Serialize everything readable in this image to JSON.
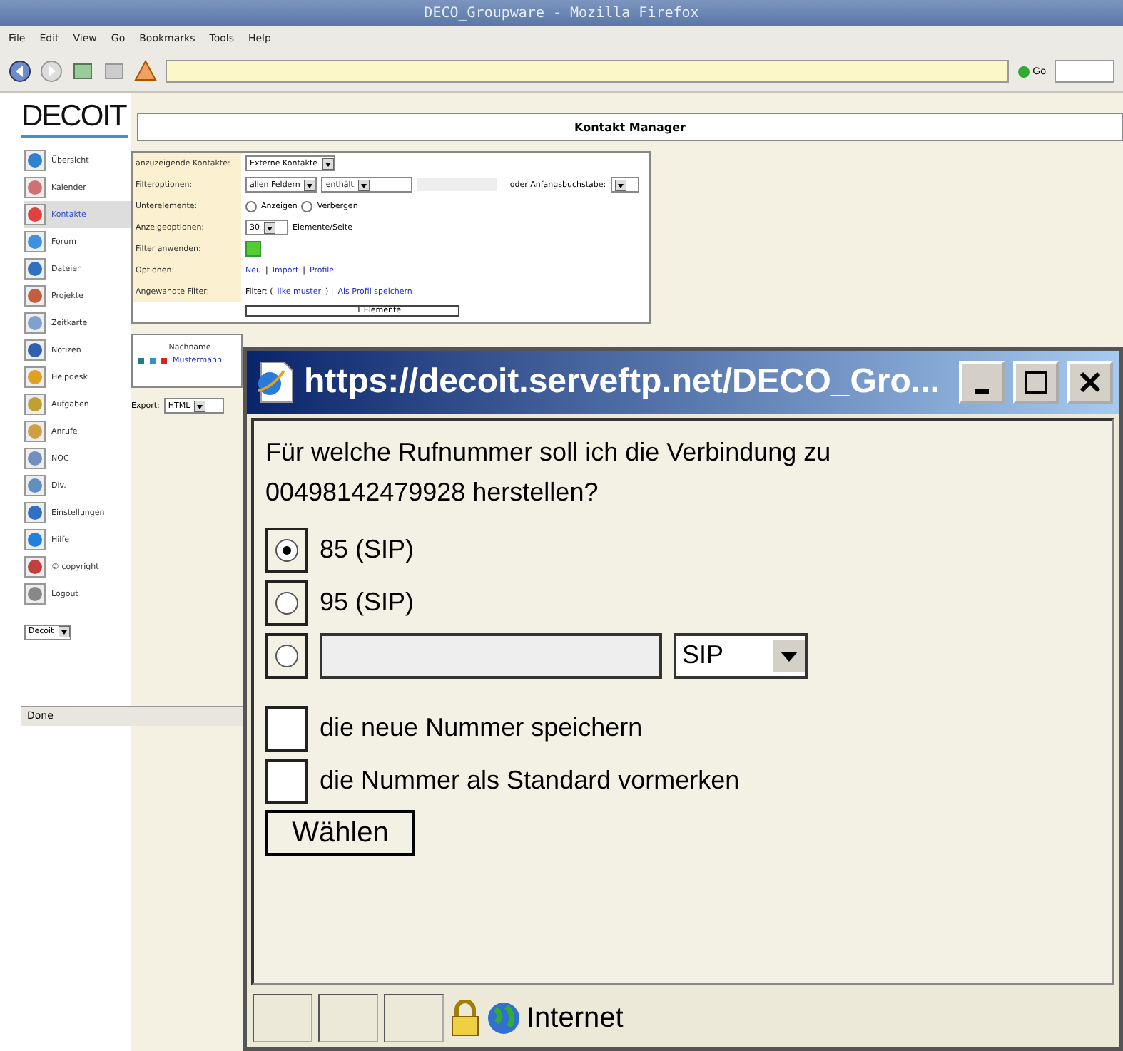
{
  "browser": {
    "title": "DECO_Groupware - Mozilla Firefox",
    "menu": [
      "File",
      "Edit",
      "View",
      "Go",
      "Bookmarks",
      "Tools",
      "Help"
    ],
    "search_button": "Go",
    "status": "Done"
  },
  "logo": "DECOIT",
  "sidebar": {
    "items": [
      {
        "label": "Übersicht",
        "selected": false
      },
      {
        "label": "Kalender",
        "selected": false
      },
      {
        "label": "Kontakte",
        "selected": true
      },
      {
        "label": "Forum",
        "selected": false
      },
      {
        "label": "Dateien",
        "selected": false
      },
      {
        "label": "Projekte",
        "selected": false
      },
      {
        "label": "Zeitkarte",
        "selected": false
      },
      {
        "label": "Notizen",
        "selected": false
      },
      {
        "label": "Helpdesk",
        "selected": false
      },
      {
        "label": "Aufgaben",
        "selected": false
      },
      {
        "label": "Anrufe",
        "selected": false
      },
      {
        "label": "NOC",
        "selected": false
      },
      {
        "label": "Div.",
        "selected": false
      },
      {
        "label": "Einstellungen",
        "selected": false
      },
      {
        "label": "Hilfe",
        "selected": false
      },
      {
        "label": "© copyright",
        "selected": false
      },
      {
        "label": "Logout",
        "selected": false
      }
    ],
    "group_select": "Decoit"
  },
  "header": "Kontakt Manager",
  "filter": {
    "rows": [
      {
        "label": "anzuzeigende Kontakte:",
        "kind": "select",
        "value": "Externe Kontakte"
      },
      {
        "label": "Filteroptionen:",
        "kind": "filter",
        "field": "allen Feldern",
        "op": "enthält",
        "letter_label": "oder Anfangsbuchstabe:"
      },
      {
        "label": "Unterelemente:",
        "kind": "radios",
        "options": [
          {
            "label": "Anzeigen",
            "selected": false
          },
          {
            "label": "Verbergen",
            "selected": false
          }
        ]
      },
      {
        "label": "Anzeigeoptionen:",
        "kind": "count",
        "value": "30",
        "suffix": "Elemente/Seite"
      },
      {
        "label": "Filter anwenden:",
        "kind": "apply"
      },
      {
        "label": "Optionen:",
        "kind": "links",
        "links": [
          "Neu",
          "Import",
          "Profile"
        ],
        "separator": "|"
      },
      {
        "label": "Angewandte Filter:",
        "kind": "applied",
        "prefix": "Filter: (",
        "link": "like muster",
        "suffix": ") |",
        "save": "Als Profil speichern"
      }
    ],
    "result": "1 Elemente"
  },
  "list": {
    "column": "Nachname",
    "row": {
      "name": "Mustermann",
      "dots": [
        {
          "color": "#208080"
        },
        {
          "color": "#3090d0"
        },
        {
          "color": "#e02020"
        }
      ]
    }
  },
  "export": {
    "label": "Export:",
    "format": "HTML"
  },
  "popup": {
    "title": "https://decoit.serveftp.net/DECO_Gro...",
    "question": "Für welche Rufnummer soll ich die Verbindung zu 00498142479928 herstellen?",
    "options": [
      {
        "kind": "fixed",
        "label": "85 (SIP)",
        "selected": true
      },
      {
        "kind": "fixed",
        "label": "95 (SIP)",
        "selected": false
      },
      {
        "kind": "custom",
        "protocol": "SIP",
        "selected": false
      }
    ],
    "checkboxes": [
      {
        "label": "die neue Nummer speichern",
        "checked": false
      },
      {
        "label": "die Nummer als Standard vormerken",
        "checked": false
      }
    ],
    "button": "Wählen",
    "zone": "Internet"
  }
}
